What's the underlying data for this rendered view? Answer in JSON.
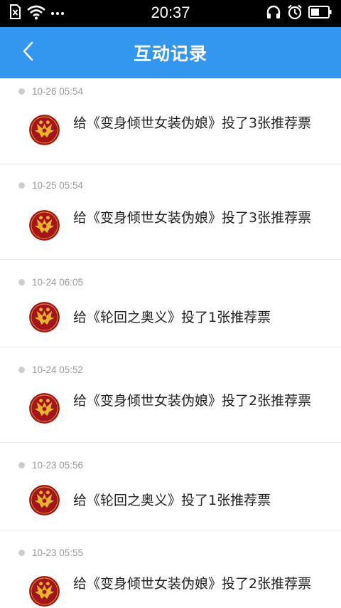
{
  "status_bar": {
    "time": "20:37",
    "icons": [
      "sim-x-icon",
      "wifi-icon",
      "more-dots-icon",
      "headphones-icon",
      "alarm-icon",
      "battery-icon"
    ]
  },
  "header": {
    "title": "互动记录",
    "back_icon": "chevron-left-icon"
  },
  "colors": {
    "header_bg": "#3397f0",
    "status_bg": "#000000",
    "timestamp": "#9a9a9a",
    "text": "#222222",
    "avatar_bg": "#a5141b",
    "avatar_emblem": "#e6b52a"
  },
  "records": [
    {
      "time": "10-26 05:54",
      "text": "给《变身倾世女装伪娘》投了3张推荐票",
      "avatar_icon": "double-headed-eagle-icon"
    },
    {
      "time": "10-25 05:54",
      "text": "给《变身倾世女装伪娘》投了3张推荐票",
      "avatar_icon": "double-headed-eagle-icon"
    },
    {
      "time": "10-24 06:05",
      "text": "给《轮回之奥义》投了1张推荐票",
      "avatar_icon": "double-headed-eagle-icon"
    },
    {
      "time": "10-24 05:52",
      "text": "给《变身倾世女装伪娘》投了2张推荐票",
      "avatar_icon": "double-headed-eagle-icon"
    },
    {
      "time": "10-23 05:56",
      "text": "给《轮回之奥义》投了1张推荐票",
      "avatar_icon": "double-headed-eagle-icon"
    },
    {
      "time": "10-23 05:55",
      "text": "给《变身倾世女装伪娘》投了2张推荐票",
      "avatar_icon": "double-headed-eagle-icon"
    }
  ]
}
